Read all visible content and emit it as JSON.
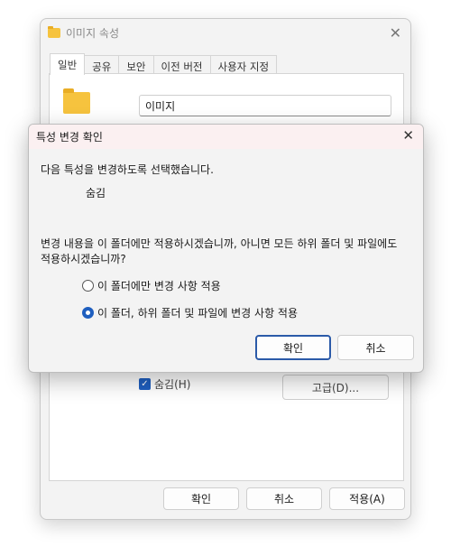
{
  "props_window": {
    "title": "이미지 속성",
    "close_glyph": "✕",
    "tabs": [
      "일반",
      "공유",
      "보안",
      "이전 버전",
      "사용자 지정"
    ],
    "folder_name": "이미지",
    "hidden_label": "숨김(H)",
    "advanced_label": "고급(D)...",
    "buttons": {
      "ok": "확인",
      "cancel": "취소",
      "apply": "적용(A)"
    }
  },
  "dialog": {
    "title": "특성 변경 확인",
    "close_glyph": "✕",
    "intro": "다음 특성을 변경하도록 선택했습니다.",
    "attribute": "숨김",
    "question_line1": "변경 내용을 이 폴더에만 적용하시겠습니까, 아니면 모든 하위 폴더 및 파일에도",
    "question_line2": "적용하시겠습니까?",
    "option_this_folder": "이 폴더에만 변경 사항 적용",
    "option_all": "이 폴더, 하위 폴더 및 파일에 변경 사항 적용",
    "selected_option": "all",
    "ok_label": "확인",
    "cancel_label": "취소"
  },
  "colors": {
    "accent": "#1f5fbf",
    "folder": "#f6c33e",
    "dialog_titlebar": "#fbf0f1"
  },
  "icons": [
    "folder-icon",
    "close-icon",
    "checkbox-checked-icon",
    "radio-icon"
  ]
}
